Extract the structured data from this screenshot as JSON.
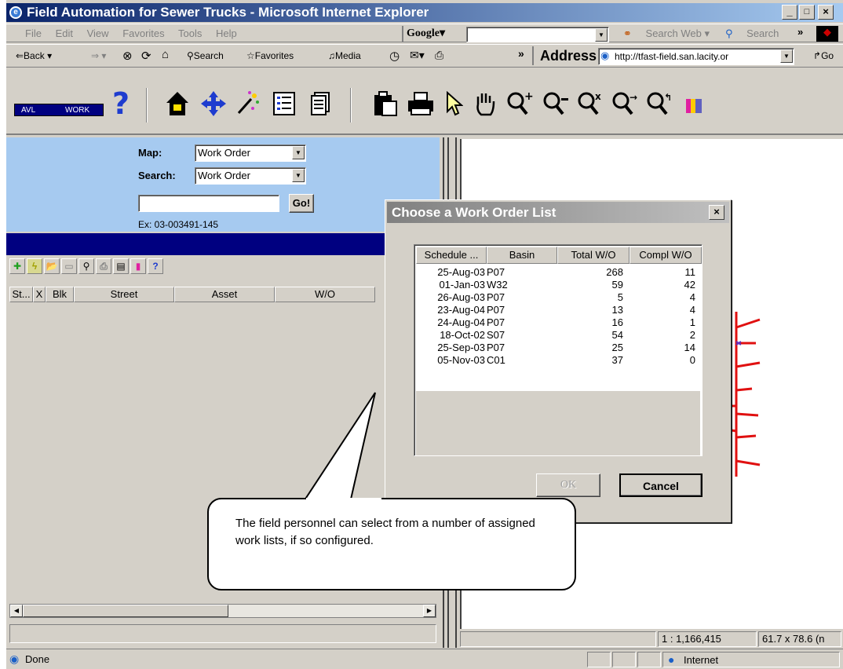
{
  "window": {
    "title": "Field Automation for Sewer Trucks - Microsoft Internet Explorer",
    "min": "_",
    "max": "□",
    "close": "×"
  },
  "menu": [
    "File",
    "Edit",
    "View",
    "Favorites",
    "Tools",
    "Help"
  ],
  "google": {
    "label": "Google▾",
    "search_web": "Search Web ▾",
    "search": "Search",
    "more": "»"
  },
  "nav": {
    "back": "⇐Back ▾",
    "forward": "⇒ ▾",
    "search": "Search",
    "favorites": "Favorites",
    "media": "Media",
    "more": "»",
    "address_label": "Address",
    "address_value": "http://tfast-field.san.lacity.or",
    "go": "Go"
  },
  "gis_toolbar": {
    "avl": "AVL",
    "work": "WORK",
    "help": "?"
  },
  "left_panel": {
    "map_label": "Map:",
    "map_value": "Work Order",
    "search_label": "Search:",
    "search_value": "Work Order",
    "search_input": "",
    "go_button": "Go!",
    "example": "Ex: 03-003491-145",
    "mini_help": "?",
    "columns": [
      "St...",
      "X",
      "Blk",
      "Street",
      "Asset",
      "W/O"
    ]
  },
  "map_status": {
    "scale": "1 : 1,166,415",
    "dimensions": "61.7 x 78.6 (n"
  },
  "status_bar": {
    "text": "Done",
    "zone": "Internet"
  },
  "dialog": {
    "title": "Choose a Work Order List",
    "close": "×",
    "columns": [
      "Schedule ...",
      "Basin",
      "Total W/O",
      "Compl W/O"
    ],
    "rows": [
      {
        "date": "25-Aug-03",
        "basin": "P07",
        "total": "268",
        "compl": "11"
      },
      {
        "date": "01-Jan-03",
        "basin": "W32",
        "total": "59",
        "compl": "42"
      },
      {
        "date": "26-Aug-03",
        "basin": "P07",
        "total": "5",
        "compl": "4"
      },
      {
        "date": "23-Aug-04",
        "basin": "P07",
        "total": "13",
        "compl": "4"
      },
      {
        "date": "24-Aug-04",
        "basin": "P07",
        "total": "16",
        "compl": "1"
      },
      {
        "date": "18-Oct-02",
        "basin": "S07",
        "total": "54",
        "compl": "2"
      },
      {
        "date": "25-Sep-03",
        "basin": "P07",
        "total": "25",
        "compl": "14"
      },
      {
        "date": "05-Nov-03",
        "basin": "C01",
        "total": "37",
        "compl": "0"
      }
    ],
    "ok": "OK",
    "cancel": "Cancel"
  },
  "callout": {
    "text": "The field personnel can select from a number of assigned work lists, if so configured."
  }
}
